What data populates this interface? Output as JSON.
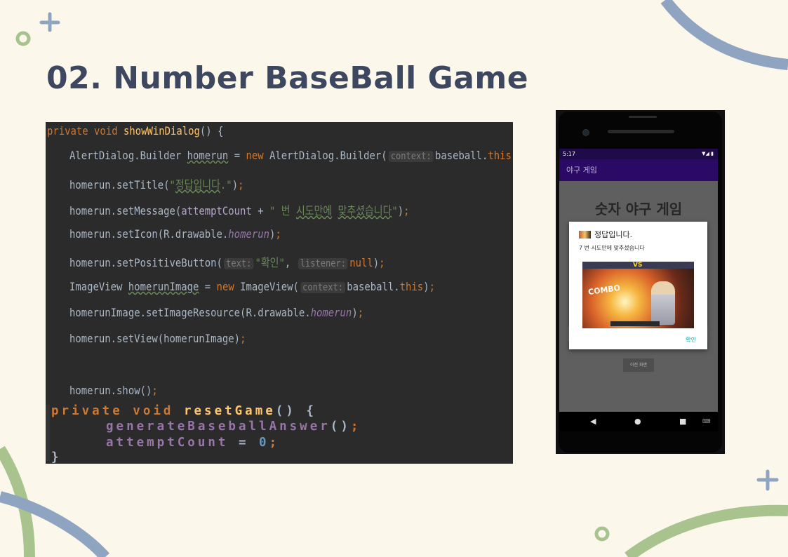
{
  "slide": {
    "title": "02. Number BaseBall Game"
  },
  "code": {
    "lines": [
      "private void showWinDialog() {",
      "AlertDialog.Builder homerun = new AlertDialog.Builder(context: baseball.this);",
      "homerun.setTitle(\"정답입니다.\");",
      "homerun.setMessage(attemptCount + \" 번 시도만에 맞추셨습니다\");",
      "homerun.setIcon(R.drawable.homerun);",
      "homerun.setPositiveButton(text: \"확인\", listener: null);",
      "ImageView homerunImage = new ImageView(context: baseball.this);",
      "homerunImage.setImageResource(R.drawable.homerun);",
      "homerun.setView(homerunImage);",
      "homerun.show();",
      "private void resetGame() {",
      "generateBaseballAnswer();",
      "attemptCount = 0;",
      "}"
    ],
    "hints": {
      "context": "context:",
      "text": "text:",
      "listener": "listener:"
    },
    "colors": {
      "background": "#2b2b2b",
      "keyword": "#cc7832",
      "method": "#ffc66d",
      "string": "#6a8759",
      "field": "#9876aa",
      "plain": "#a9b7c6"
    }
  },
  "phone": {
    "status_time": "5:17",
    "status_icons": "▼◢ ▮",
    "appbar_title": "야구 게임",
    "game_title": "숫자 야구 게임",
    "dialog": {
      "title": "정답입니다.",
      "message": "7 번 시도만에 맞추셨습니다",
      "positive_button": "확인",
      "image_text_vs": "VS",
      "image_text_combo": "COMBO"
    },
    "prev_button": "이전 화면",
    "nav": {
      "back": "◀",
      "home": "●",
      "recent": "■",
      "keyboard": "⌨"
    },
    "colors": {
      "statusbar": "#1f0a4a",
      "appbar": "#2b0a66",
      "dialog_button": "#18a3a3"
    }
  },
  "decor": {
    "plus_glyph": "+",
    "colors": {
      "blue": "#8fa4c0",
      "green": "#a9c38f"
    }
  }
}
